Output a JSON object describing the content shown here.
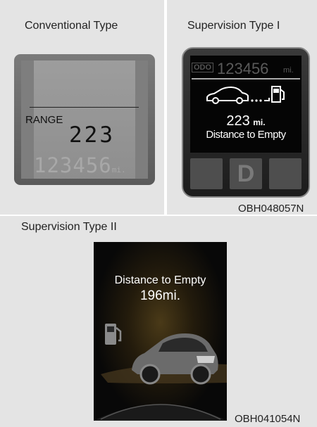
{
  "captions": {
    "conventional": "Conventional Type",
    "supervision_1": "Supervision Type I",
    "supervision_2": "Supervision Type II",
    "code_1": "OBH048057N",
    "code_2": "OBH041054N"
  },
  "conventional": {
    "range_label": "RANGE",
    "range_value": "223",
    "odometer": "123456",
    "odometer_unit": "mi."
  },
  "supervision_1": {
    "odo_label": "ODO",
    "odometer": "123456",
    "odometer_unit": "mi.",
    "distance_value": "223",
    "distance_unit": "mi.",
    "distance_label": "Distance to Empty",
    "gear": "D"
  },
  "supervision_2": {
    "distance_label": "Distance to Empty",
    "distance_value": "196mi."
  },
  "colors": {
    "lcd_digits": "#111111",
    "lcd_ghost": "#aaaaaa",
    "screen_text": "#ffffff"
  }
}
